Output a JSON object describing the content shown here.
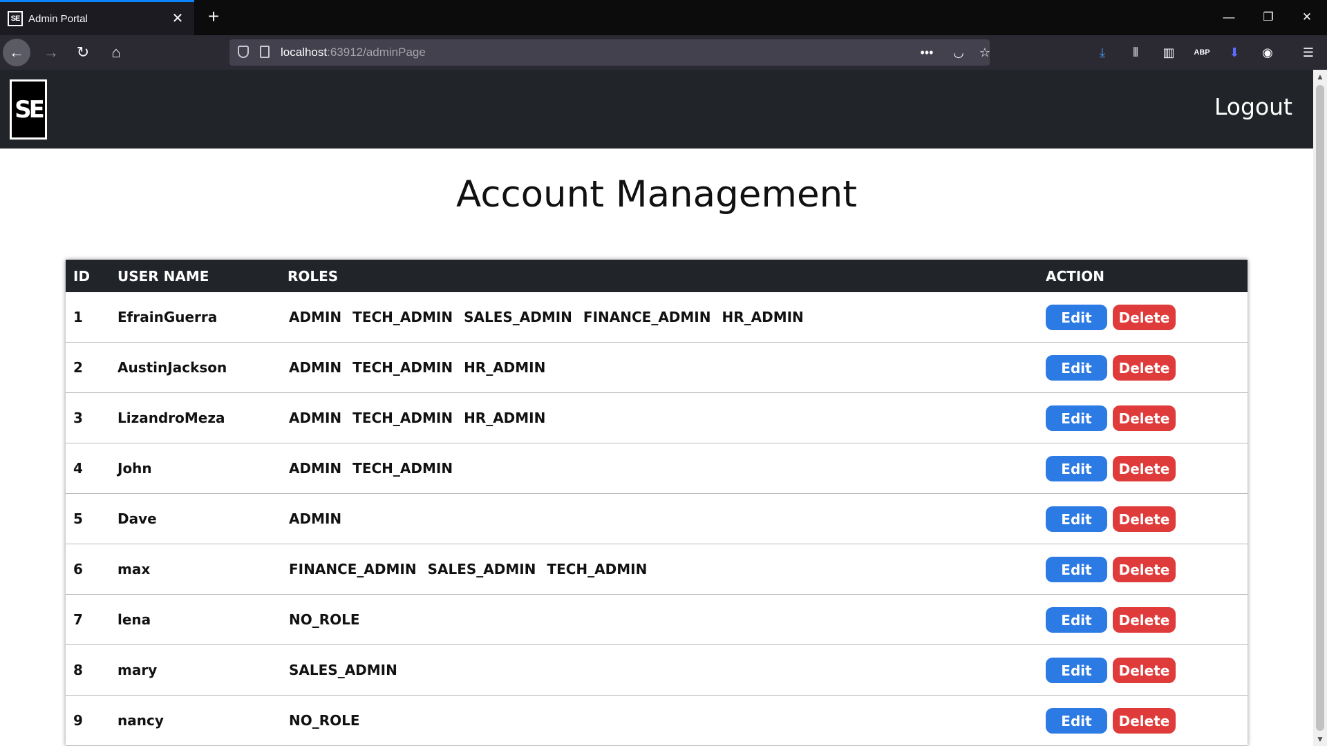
{
  "browser": {
    "tab_title": "Admin Portal",
    "tab_favicon": "SE",
    "url_host": "localhost",
    "url_rest": ":63912/adminPage"
  },
  "header": {
    "logo_text": "SE",
    "logout_label": "Logout"
  },
  "page": {
    "title": "Account Management"
  },
  "table": {
    "headers": {
      "id": "ID",
      "username": "USER NAME",
      "roles": "ROLES",
      "action": "ACTION"
    },
    "rows": [
      {
        "id": "1",
        "username": "EfrainGuerra",
        "roles": [
          "ADMIN",
          "TECH_ADMIN",
          "SALES_ADMIN",
          "FINANCE_ADMIN",
          "HR_ADMIN"
        ]
      },
      {
        "id": "2",
        "username": "AustinJackson",
        "roles": [
          "ADMIN",
          "TECH_ADMIN",
          "HR_ADMIN"
        ]
      },
      {
        "id": "3",
        "username": "LizandroMeza",
        "roles": [
          "ADMIN",
          "TECH_ADMIN",
          "HR_ADMIN"
        ]
      },
      {
        "id": "4",
        "username": "John",
        "roles": [
          "ADMIN",
          "TECH_ADMIN"
        ]
      },
      {
        "id": "5",
        "username": "Dave",
        "roles": [
          "ADMIN"
        ]
      },
      {
        "id": "6",
        "username": "max",
        "roles": [
          "FINANCE_ADMIN",
          "SALES_ADMIN",
          "TECH_ADMIN"
        ]
      },
      {
        "id": "7",
        "username": "lena",
        "roles": [
          "NO_ROLE"
        ]
      },
      {
        "id": "8",
        "username": "mary",
        "roles": [
          "SALES_ADMIN"
        ]
      },
      {
        "id": "9",
        "username": "nancy",
        "roles": [
          "NO_ROLE"
        ]
      }
    ],
    "edit_label": "Edit",
    "delete_label": "Delete"
  },
  "colors": {
    "header_bg": "#212529",
    "edit": "#2c7be5",
    "delete": "#e03b3b",
    "tab_accent": "#0a84ff"
  }
}
